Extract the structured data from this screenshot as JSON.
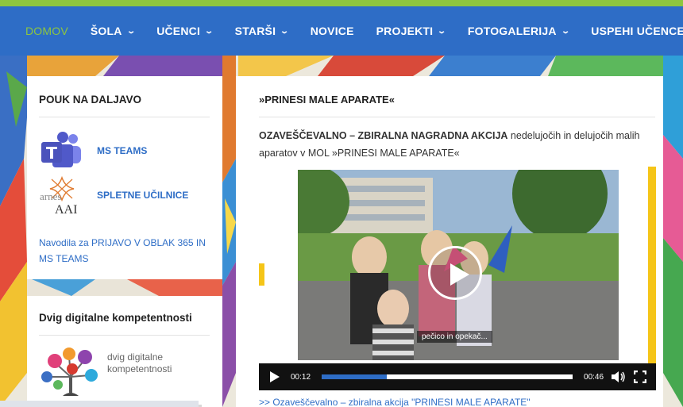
{
  "nav": {
    "items": [
      {
        "label": "DOMOV",
        "active": true,
        "dropdown": false
      },
      {
        "label": "ŠOLA",
        "dropdown": true
      },
      {
        "label": "UČENCI",
        "dropdown": true
      },
      {
        "label": "STARŠI",
        "dropdown": true
      },
      {
        "label": "NOVICE",
        "dropdown": false
      },
      {
        "label": "PROJEKTI",
        "dropdown": true
      },
      {
        "label": "FOTOGALERIJA",
        "dropdown": true
      },
      {
        "label": "USPEHI UČENCEV",
        "dropdown": true
      }
    ],
    "chevron": "⌄"
  },
  "sidebar": {
    "widget1": {
      "title": "POUK NA DALJAVO",
      "links": [
        {
          "label": "MS TEAMS",
          "icon": "ms-teams-logo"
        },
        {
          "label": "SPLETNE UČILNICE",
          "icon": "arnes-aai-logo"
        }
      ],
      "logo_text": {
        "arnes": "arnes",
        "aai": "AAI"
      },
      "note": "Navodila za PRIJAVO V OBLAK 365 IN MS TEAMS"
    },
    "widget2": {
      "title": "Dvig digitalne kompetentnosti",
      "logo_text_line1": "dvig digitalne",
      "logo_text_line2": "kompetentnosti"
    }
  },
  "main": {
    "title": "»PRINESI MALE APARATE«",
    "description_bold": "OZAVEŠČEVALNO – ZBIRALNA NAGRADNA AKCIJA",
    "description_rest": " nedelujočih in delujočih malih aparatov v MOL »PRINESI MALE APARATE«",
    "video": {
      "caption": "pečico in opekač...",
      "current_time": "00:12",
      "duration": "00:46",
      "progress_fraction": 0.26
    },
    "below_link": ">> Ozaveščevalno – zbiralna akcija \"PRINESI MALE APARATE\""
  },
  "colors": {
    "nav_bg": "#2e6dc6",
    "accent_green": "#8ec63f",
    "link_blue": "#2e6dc6",
    "yellow": "#f5c518"
  }
}
